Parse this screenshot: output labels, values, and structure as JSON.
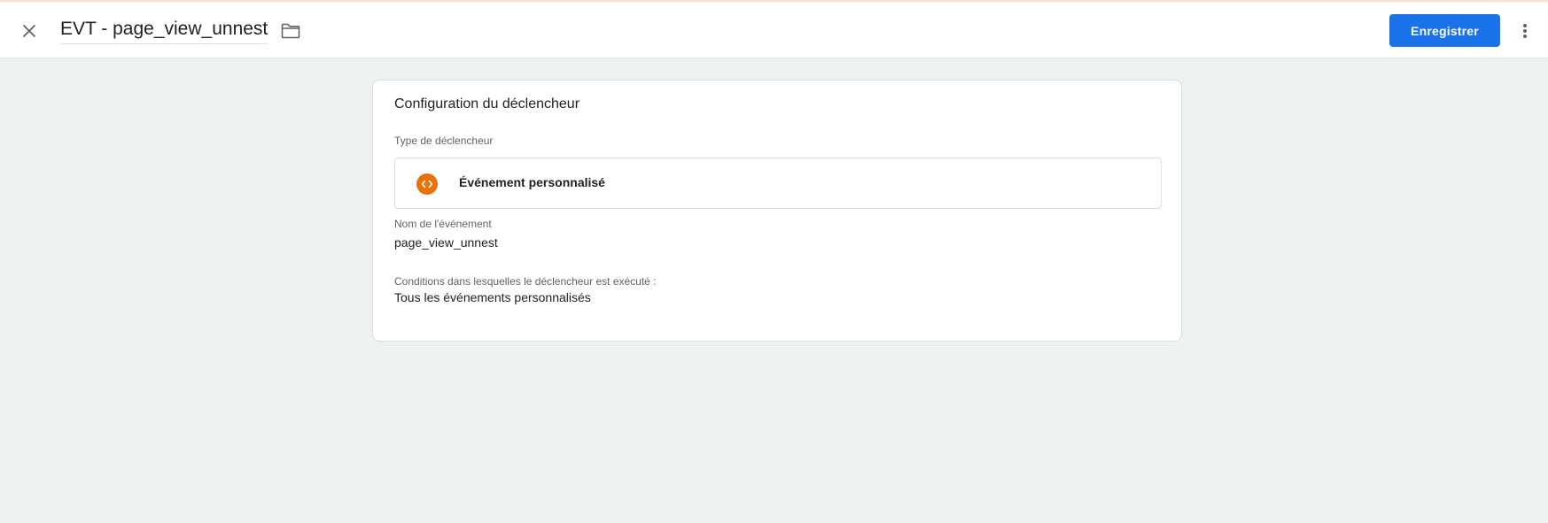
{
  "header": {
    "title": "EVT - page_view_unnest",
    "save_label": "Enregistrer",
    "close_icon": "close-icon",
    "folder_icon": "folder-icon",
    "more_icon": "more-vert-icon"
  },
  "card": {
    "title": "Configuration du déclencheur",
    "trigger_type": {
      "label": "Type de déclencheur",
      "value": "Événement personnalisé",
      "icon": "custom-event-code-icon",
      "icon_color": "#e8710a"
    },
    "event_name": {
      "label": "Nom de l'événement",
      "value": "page_view_unnest"
    },
    "conditions": {
      "label": "Conditions dans lesquelles le déclencheur est exécuté :",
      "value": "Tous les événements personnalisés"
    }
  },
  "colors": {
    "primary": "#1a73e8",
    "background": "#eef1f2",
    "accent_orange": "#e8710a"
  }
}
